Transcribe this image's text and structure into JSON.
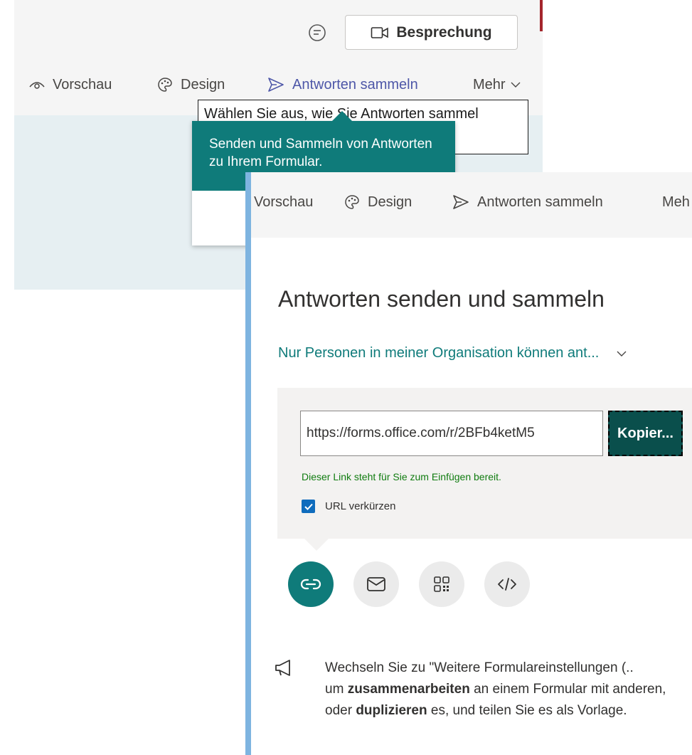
{
  "back": {
    "meeting_button": "Besprechung",
    "toolbar": [
      {
        "label": "Vorschau",
        "icon": "eye-icon"
      },
      {
        "label": "Design",
        "icon": "palette-icon"
      },
      {
        "label": "Antworten sammeln",
        "icon": "send-icon"
      },
      {
        "label": "Mehr",
        "icon": "chevron-down-icon"
      }
    ],
    "tooltip_text": "Wählen Sie aus, wie Sie Antworten sammel",
    "callout_text": "Senden und Sammeln von Antworten zu Ihrem Formular."
  },
  "front": {
    "toolbar": [
      {
        "label": "Vorschau"
      },
      {
        "label": "Design",
        "icon": "palette-icon"
      },
      {
        "label": "Antworten sammeln",
        "icon": "send-icon"
      },
      {
        "label": "Meh"
      }
    ],
    "title": "Antworten senden und sammeln",
    "audience": "Nur Personen in meiner Organisation können ant...",
    "url_value": "https://forms.office.com/r/2BFb4ketM5",
    "copy_button": "Kopier...",
    "success_message": "Dieser Link steht für Sie zum Einfügen bereit.",
    "shorten_url_label": "URL verkürzen",
    "shorten_url_checked": true,
    "share_options": [
      {
        "icon": "link-icon",
        "active": true
      },
      {
        "icon": "mail-icon",
        "active": false
      },
      {
        "icon": "qr-code-icon",
        "active": false
      },
      {
        "icon": "embed-code-icon",
        "active": false
      }
    ],
    "hint": {
      "part1": "Wechseln Sie zu \"Weitere Formulareinstellungen (..",
      "part2": "um ",
      "bold1": "zusammenarbeiten",
      "part3": " an einem Formular mit anderen, oder ",
      "bold2": "duplizieren",
      "part4": " es, und teilen Sie es als Vorlage."
    }
  },
  "colors": {
    "accent_teal": "#0f7b7a",
    "active_purple": "#4e57a8",
    "success_green": "#107c10",
    "copy_button_bg": "#0a4f4c"
  }
}
